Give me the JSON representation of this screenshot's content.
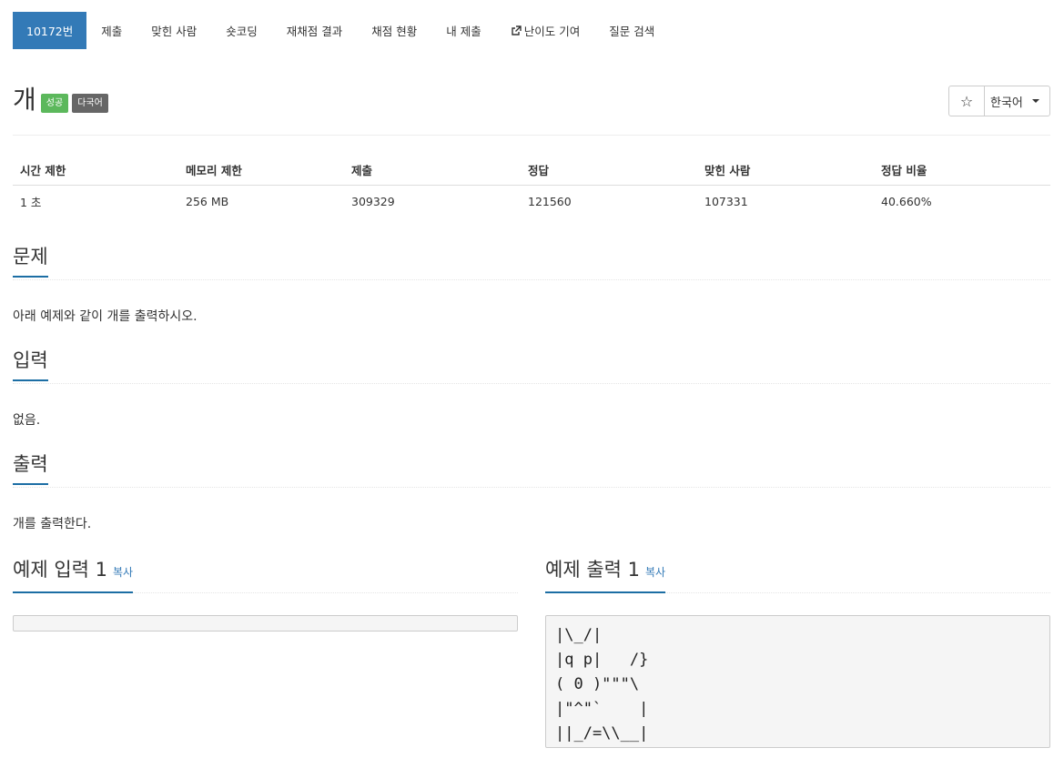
{
  "nav": {
    "problem_id": "10172번",
    "items": [
      "제출",
      "맞힌 사람",
      "숏코딩",
      "재채점 결과",
      "채점 현황",
      "내 제출"
    ],
    "difficulty_label": "난이도 기여",
    "qna_label": "질문 검색"
  },
  "problem": {
    "title": "개",
    "badge_success": "성공",
    "badge_multilang": "다국어",
    "star_icon": "star-outline",
    "language": "한국어"
  },
  "stats": {
    "headers": [
      "시간 제한",
      "메모리 제한",
      "제출",
      "정답",
      "맞힌 사람",
      "정답 비율"
    ],
    "values": [
      "1 초",
      "256 MB",
      "309329",
      "121560",
      "107331",
      "40.660%"
    ]
  },
  "sections": {
    "problem_heading": "문제",
    "problem_text": "아래 예제와 같이 개를 출력하시오.",
    "input_heading": "입력",
    "input_text": "없음.",
    "output_heading": "출력",
    "output_text": "개를 출력한다."
  },
  "samples": {
    "input_heading": "예제 입력 1",
    "output_heading": "예제 출력 1",
    "copy_label": "복사",
    "input_value": "",
    "output_value": "|\\_/|\n|q p|   /}\n( 0 )\"\"\"\\\n|\"^\"`    |\n||_/=\\\\__|"
  },
  "colors": {
    "primary": "#337ab7",
    "success": "#5cb85c",
    "default_badge": "#666666",
    "headline_underline": "#1c6ea4"
  }
}
